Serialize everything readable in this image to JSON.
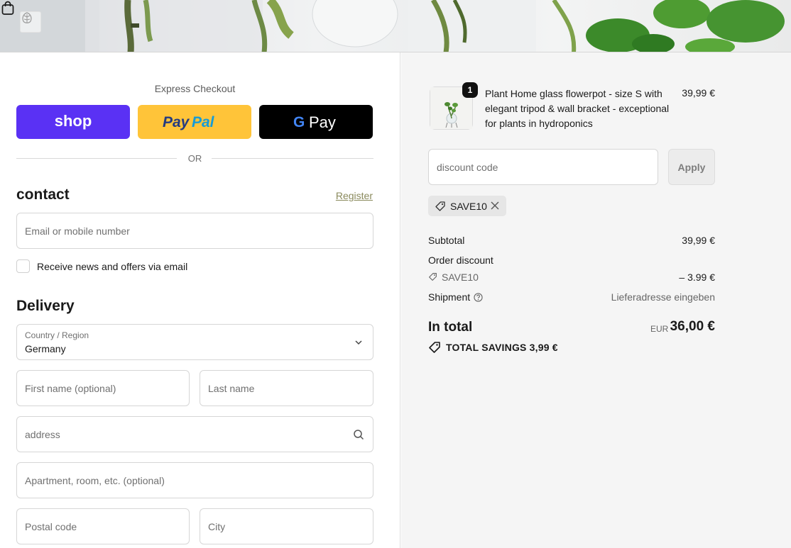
{
  "header": {
    "logo_icon": "monstera-leaf-logo",
    "cart_icon": "shopping-bag-icon"
  },
  "express": {
    "label": "Express Checkout",
    "buttons": [
      "shop",
      "PayPal",
      "G Pay"
    ],
    "colors": {
      "shop": "#5a31f4",
      "paypal": "#ffc439",
      "gpay": "#000000"
    }
  },
  "divider": {
    "label": "OR"
  },
  "contact": {
    "title": "contact",
    "register_link": "Register",
    "email_placeholder": "Email or mobile number",
    "newsletter_label": "Receive news and offers via email",
    "newsletter_checked": false
  },
  "delivery": {
    "title": "Delivery",
    "country_label": "Country / Region",
    "country_value": "Germany",
    "first_name_placeholder": "First name (optional)",
    "last_name_placeholder": "Last name",
    "address_placeholder": "address",
    "apartment_placeholder": "Apartment, room, etc. (optional)",
    "postal_placeholder": "Postal code",
    "city_placeholder": "City"
  },
  "order": {
    "product": {
      "quantity": "1",
      "name": "Plant Home glass flowerpot - size S with elegant tripod & wall bracket - exceptional for plants in hydroponics",
      "price": "39,99 €"
    },
    "discount_placeholder": "discount code",
    "apply_label": "Apply",
    "applied_code": "SAVE10",
    "summary": {
      "subtotal_label": "Subtotal",
      "subtotal_value": "39,99 €",
      "order_discount_label": "Order discount",
      "discount_code": "SAVE10",
      "discount_value": "– 3.99 €",
      "shipment_label": "Shipment",
      "shipment_value": "Lieferadresse eingeben",
      "total_label": "In total",
      "total_currency": "EUR",
      "total_value": "36,00 €",
      "savings_label": "TOTAL SAVINGS",
      "savings_value": "3,99 €"
    }
  }
}
